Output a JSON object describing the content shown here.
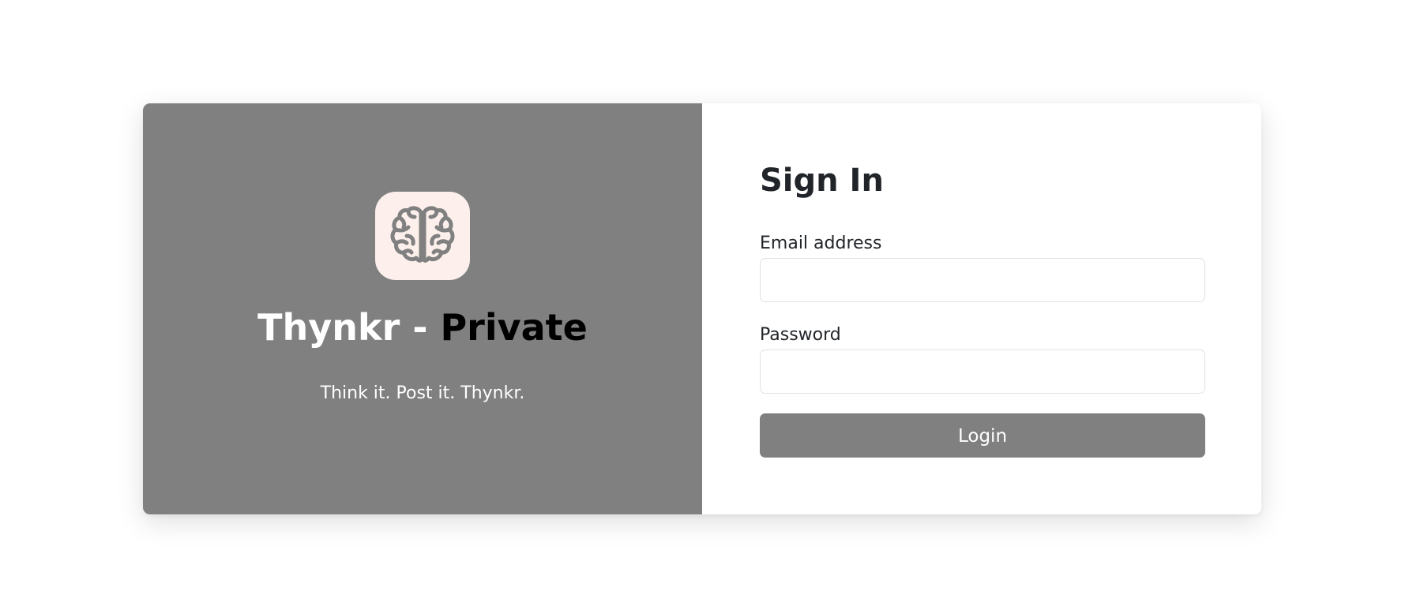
{
  "brand": {
    "logo_icon": "brain-icon",
    "name": "Thynkr",
    "separator": "-",
    "variant": "Private",
    "tagline": "Think it. Post it. Thynkr."
  },
  "form": {
    "title": "Sign In",
    "email_label": "Email address",
    "email_value": "",
    "password_label": "Password",
    "password_value": "",
    "login_label": "Login"
  },
  "colors": {
    "brand_panel": "#808080",
    "logo_background": "#fdf0ec",
    "logo_stroke": "#808080",
    "button": "#808080",
    "text_dark": "#212529",
    "input_border": "#dee2e6"
  }
}
